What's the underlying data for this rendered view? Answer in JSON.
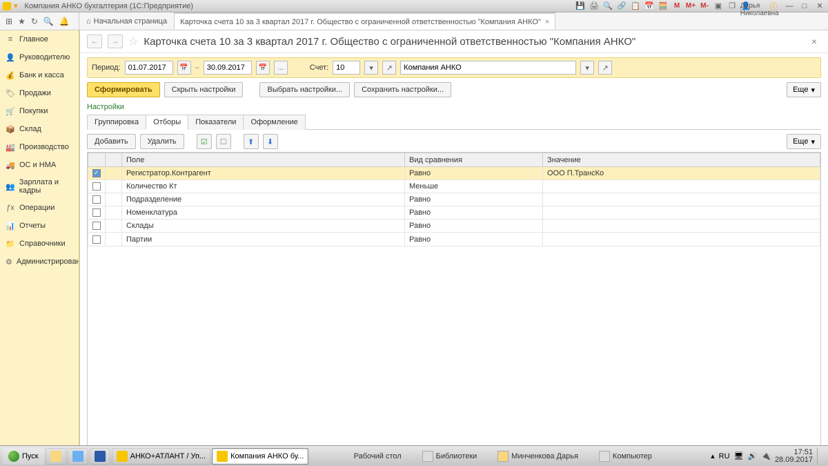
{
  "window": {
    "title": "Компания АНКО бухгалтерия (1С:Предприятие)",
    "user": "Минченкова Дарья Николаевна"
  },
  "toolbar": {
    "m1": "M",
    "m2": "M+",
    "m3": "M-",
    "home_tab": "Начальная страница",
    "active_tab": "Карточка счета 10 за 3 квартал 2017 г. Общество с ограниченной ответственностью \"Компания АНКО\""
  },
  "sidebar": {
    "items": [
      {
        "icon": "≡",
        "label": "Главное"
      },
      {
        "icon": "👤",
        "label": "Руководителю"
      },
      {
        "icon": "💰",
        "label": "Банк и касса"
      },
      {
        "icon": "🏷",
        "label": "Продажи"
      },
      {
        "icon": "🛒",
        "label": "Покупки"
      },
      {
        "icon": "📦",
        "label": "Склад"
      },
      {
        "icon": "🏭",
        "label": "Производство"
      },
      {
        "icon": "🚚",
        "label": "ОС и НМА"
      },
      {
        "icon": "👥",
        "label": "Зарплата и кадры"
      },
      {
        "icon": "ƒx",
        "label": "Операции"
      },
      {
        "icon": "📊",
        "label": "Отчеты"
      },
      {
        "icon": "📁",
        "label": "Справочники"
      },
      {
        "icon": "⚙",
        "label": "Администрирование"
      }
    ]
  },
  "doc": {
    "title": "Карточка счета 10 за 3 квартал 2017 г. Общество с ограниченной ответственностью \"Компания АНКО\"",
    "period_label": "Период:",
    "date_from": "01.07.2017",
    "date_to": "30.09.2017",
    "dots": "...",
    "account_label": "Счет:",
    "account": "10",
    "org": "Компания АНКО",
    "form_btn": "Сформировать",
    "hide_btn": "Скрыть настройки",
    "select_btn": "Выбрать настройки...",
    "save_btn": "Сохранить настройки...",
    "more_btn": "Еще",
    "settings_label": "Настройки"
  },
  "subtabs": {
    "t1": "Группировка",
    "t2": "Отборы",
    "t3": "Показатели",
    "t4": "Оформление"
  },
  "filter_bar": {
    "add": "Добавить",
    "del": "Удалить",
    "more": "Еще"
  },
  "table": {
    "col_field": "Поле",
    "col_comp": "Вид сравнения",
    "col_val": "Значение",
    "rows": [
      {
        "checked": true,
        "field": "Регистратор.Контрагент",
        "comp": "Равно",
        "val": "ООО П.ТрансКо"
      },
      {
        "checked": false,
        "field": "Количество Кт",
        "comp": "Меньше",
        "val": ""
      },
      {
        "checked": false,
        "field": "Подразделение",
        "comp": "Равно",
        "val": ""
      },
      {
        "checked": false,
        "field": "Номенклатура",
        "comp": "Равно",
        "val": ""
      },
      {
        "checked": false,
        "field": "Склады",
        "comp": "Равно",
        "val": ""
      },
      {
        "checked": false,
        "field": "Партии",
        "comp": "Равно",
        "val": ""
      }
    ]
  },
  "taskbar": {
    "start": "Пуск",
    "app1": "АНКО+АТЛАНТ / Уп...",
    "app2": "Компания АНКО бу...",
    "desk": "Рабочий стол",
    "lib": "Библиотеки",
    "usr": "Минченкова Дарья",
    "comp": "Компьютер",
    "lang": "RU",
    "time": "17:51",
    "date": "28.09.2017"
  }
}
